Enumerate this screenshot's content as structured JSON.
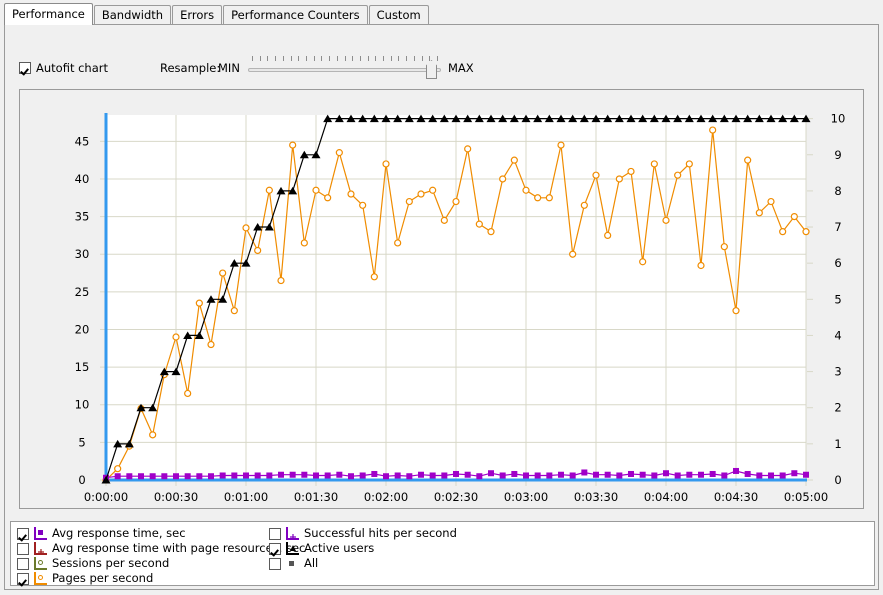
{
  "window": {
    "title": "Performance"
  },
  "tabs": [
    {
      "label": "Performance",
      "active": true
    },
    {
      "label": "Bandwidth",
      "active": false
    },
    {
      "label": "Errors",
      "active": false
    },
    {
      "label": "Performance Counters",
      "active": false
    },
    {
      "label": "Custom",
      "active": false
    }
  ],
  "toolbar": {
    "autofit_label": "Autofit chart",
    "autofit_checked": true,
    "resample_label": "Resample:",
    "min_label": "MIN",
    "max_label": "MAX",
    "slider_value": 100,
    "slider_ticks": 25
  },
  "legend": {
    "columns": [
      {
        "items": [
          {
            "label": "Avg response time, sec",
            "checked": true,
            "color": "#8000c0",
            "marker": "square",
            "icon": "series-icon-avg-response-time"
          },
          {
            "label": "Avg response time with page resources, sec",
            "checked": false,
            "color": "#a02020",
            "marker": "plus",
            "icon": "series-icon-avg-response-time-page-resources"
          },
          {
            "label": "Sessions per second",
            "checked": false,
            "color": "#6b7a2a",
            "marker": "circle",
            "icon": "series-icon-sessions-per-second"
          },
          {
            "label": "Pages per second",
            "checked": true,
            "color": "#f08c00",
            "marker": "circle",
            "icon": "series-icon-pages-per-second"
          }
        ]
      },
      {
        "items": [
          {
            "label": "Successful hits per second",
            "checked": false,
            "color": "#8000c0",
            "marker": "plus",
            "icon": "series-icon-successful-hits-per-second"
          },
          {
            "label": "Active users",
            "checked": true,
            "color": "#000000",
            "marker": "triangle",
            "icon": "series-icon-active-users"
          },
          {
            "label": "All",
            "checked": false,
            "color": "#555555",
            "marker": "square-plain",
            "icon": "series-icon-all"
          }
        ]
      }
    ]
  },
  "chart_data": {
    "type": "line",
    "title": "",
    "xlabel": "",
    "ylabel": "",
    "grid": true,
    "legend_position": "bottom",
    "axis_line_color": "#3399ee",
    "grid_color": "#d8d8c8",
    "plot_background": "#ffffff",
    "x": [
      "0:00:00",
      "0:00:10",
      "0:00:20",
      "0:00:30",
      "0:00:40",
      "0:00:50",
      "0:01:00",
      "0:01:10",
      "0:01:20",
      "0:01:30",
      "0:01:40",
      "0:01:50",
      "0:02:00",
      "0:02:10",
      "0:02:20",
      "0:02:30",
      "0:02:40",
      "0:02:50",
      "0:03:00",
      "0:03:10",
      "0:03:20",
      "0:03:30",
      "0:03:40",
      "0:03:50",
      "0:04:00",
      "0:04:10",
      "0:04:20",
      "0:04:30",
      "0:04:40",
      "0:04:50",
      "0:05:00"
    ],
    "xtick_labels": [
      "0:00:00",
      "0:00:30",
      "0:01:00",
      "0:01:30",
      "0:02:00",
      "0:02:30",
      "0:03:00",
      "0:03:30",
      "0:04:00",
      "0:04:30",
      "0:05:00"
    ],
    "xlim_seconds": [
      0,
      300
    ],
    "left_axis": {
      "ticks": [
        0,
        5,
        10,
        15,
        20,
        25,
        30,
        35,
        40,
        45
      ],
      "ylim": [
        0,
        48.5
      ],
      "label": ""
    },
    "right_axis": {
      "ticks": [
        0,
        1,
        2,
        3,
        4,
        5,
        6,
        7,
        8,
        9,
        10
      ],
      "ylim": [
        0,
        10.1
      ],
      "label": ""
    },
    "series": [
      {
        "name": "Active users",
        "axis": "right",
        "color": "#000000",
        "marker": "triangle",
        "values": [
          0,
          1,
          1,
          2,
          2,
          3,
          3,
          4,
          4,
          5,
          5,
          6,
          6,
          7,
          7,
          8,
          8,
          9,
          9,
          10,
          10,
          10,
          10,
          10,
          10,
          10,
          10,
          10,
          10,
          10,
          10,
          10,
          10,
          10,
          10,
          10,
          10,
          10,
          10,
          10,
          10,
          10,
          10,
          10,
          10,
          10,
          10,
          10,
          10,
          10,
          10,
          10,
          10,
          10,
          10,
          10,
          10,
          10,
          10,
          10,
          10
        ]
      },
      {
        "name": "Pages per second",
        "axis": "left",
        "color": "#f08c00",
        "marker": "circle",
        "values": [
          0,
          1.5,
          4.5,
          9.5,
          6.0,
          14.0,
          19.0,
          11.5,
          23.5,
          18.0,
          27.5,
          22.5,
          33.5,
          30.5,
          38.5,
          26.5,
          44.5,
          31.5,
          38.5,
          37.5,
          43.5,
          38.0,
          36.5,
          27.0,
          42.0,
          31.5,
          37.0,
          38.0,
          38.5,
          34.5,
          37.0,
          44.0,
          34.0,
          33.0,
          40.0,
          42.5,
          38.5,
          37.5,
          37.5,
          44.5,
          30.0,
          36.5,
          40.5,
          32.5,
          40.0,
          41.0,
          29.0,
          42.0,
          34.5,
          40.5,
          42.0,
          28.5,
          46.5,
          31.0,
          22.5,
          42.5,
          35.5,
          37.0,
          33.0,
          35.0,
          33.0
        ]
      },
      {
        "name": "Avg response time, sec",
        "axis": "left",
        "color": "#a000c8",
        "marker": "square",
        "values": [
          0.3,
          0.5,
          0.5,
          0.5,
          0.5,
          0.5,
          0.5,
          0.5,
          0.5,
          0.5,
          0.6,
          0.6,
          0.6,
          0.6,
          0.6,
          0.7,
          0.7,
          0.7,
          0.6,
          0.6,
          0.7,
          0.5,
          0.6,
          0.8,
          0.5,
          0.6,
          0.5,
          0.7,
          0.6,
          0.6,
          0.8,
          0.7,
          0.5,
          0.9,
          0.6,
          0.8,
          0.6,
          0.6,
          0.6,
          0.7,
          0.6,
          1.0,
          0.7,
          0.7,
          0.6,
          0.8,
          0.7,
          0.6,
          0.9,
          0.6,
          0.7,
          0.7,
          0.8,
          0.6,
          1.2,
          0.8,
          0.6,
          0.6,
          0.6,
          0.9,
          0.7
        ]
      }
    ]
  }
}
